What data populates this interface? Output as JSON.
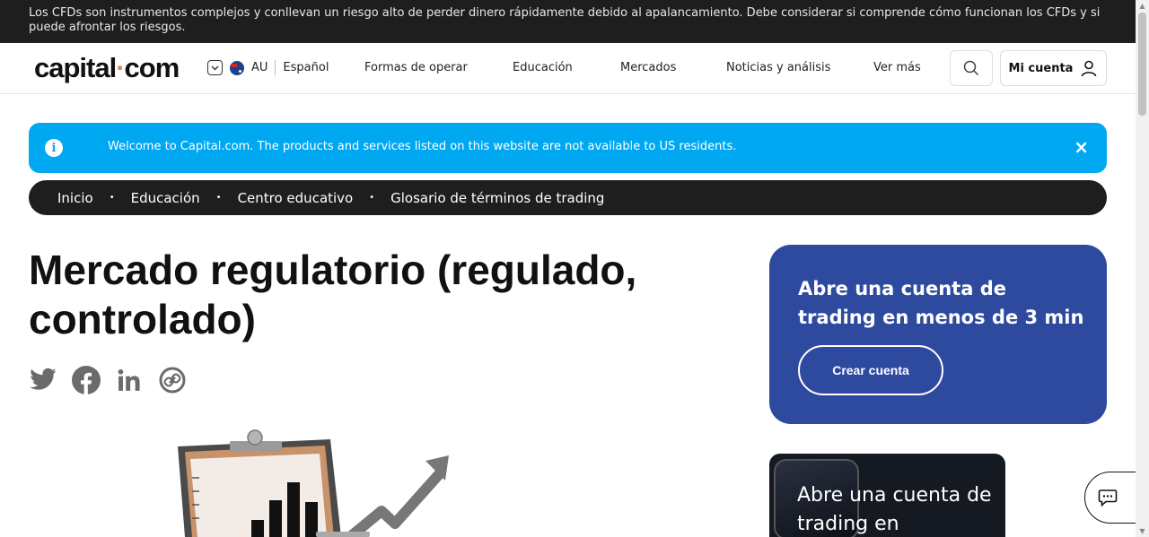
{
  "risk_warning": "Los CFDs son instrumentos complejos y conllevan un riesgo alto de perder dinero rápidamente debido al apalancamiento. Debe considerar si comprende cómo funcionan los CFDs y si puede afrontar los riesgos.",
  "header": {
    "logo_left": "capital",
    "logo_dot": "·",
    "logo_right": "com",
    "region": "AU",
    "language": "Español",
    "nav": [
      "Formas de operar",
      "Educación",
      "Mercados",
      "Noticias y análisis",
      "Ver más"
    ],
    "account_label": "Mi cuenta"
  },
  "notice": {
    "message": "Welcome to Capital.com. The products and services listed on this website are not available to US residents.",
    "close_symbol": "×",
    "info_symbol": "i"
  },
  "breadcrumb": [
    "Inicio",
    "Educación",
    "Centro educativo",
    "Glosario de términos de trading"
  ],
  "breadcrumb_sep": "•",
  "page_title": "Mercado regulatorio (regulado, controlado)",
  "cta": {
    "title": "Abre una cuenta de trading en menos de 3 min",
    "button": "Crear cuenta"
  },
  "promo": {
    "text": "Abre una cuenta de trading en"
  },
  "icons": [
    "chevron-down-icon",
    "au-flag-icon",
    "search-icon",
    "user-icon",
    "info-icon",
    "close-icon",
    "twitter-icon",
    "facebook-icon",
    "linkedin-icon",
    "link-icon",
    "chat-icon"
  ],
  "colors": {
    "risk_bar": "#1e1e1e",
    "notice": "#00a8f2",
    "cta_card": "#2e4a9e",
    "logo_dot": "#e8823a"
  }
}
